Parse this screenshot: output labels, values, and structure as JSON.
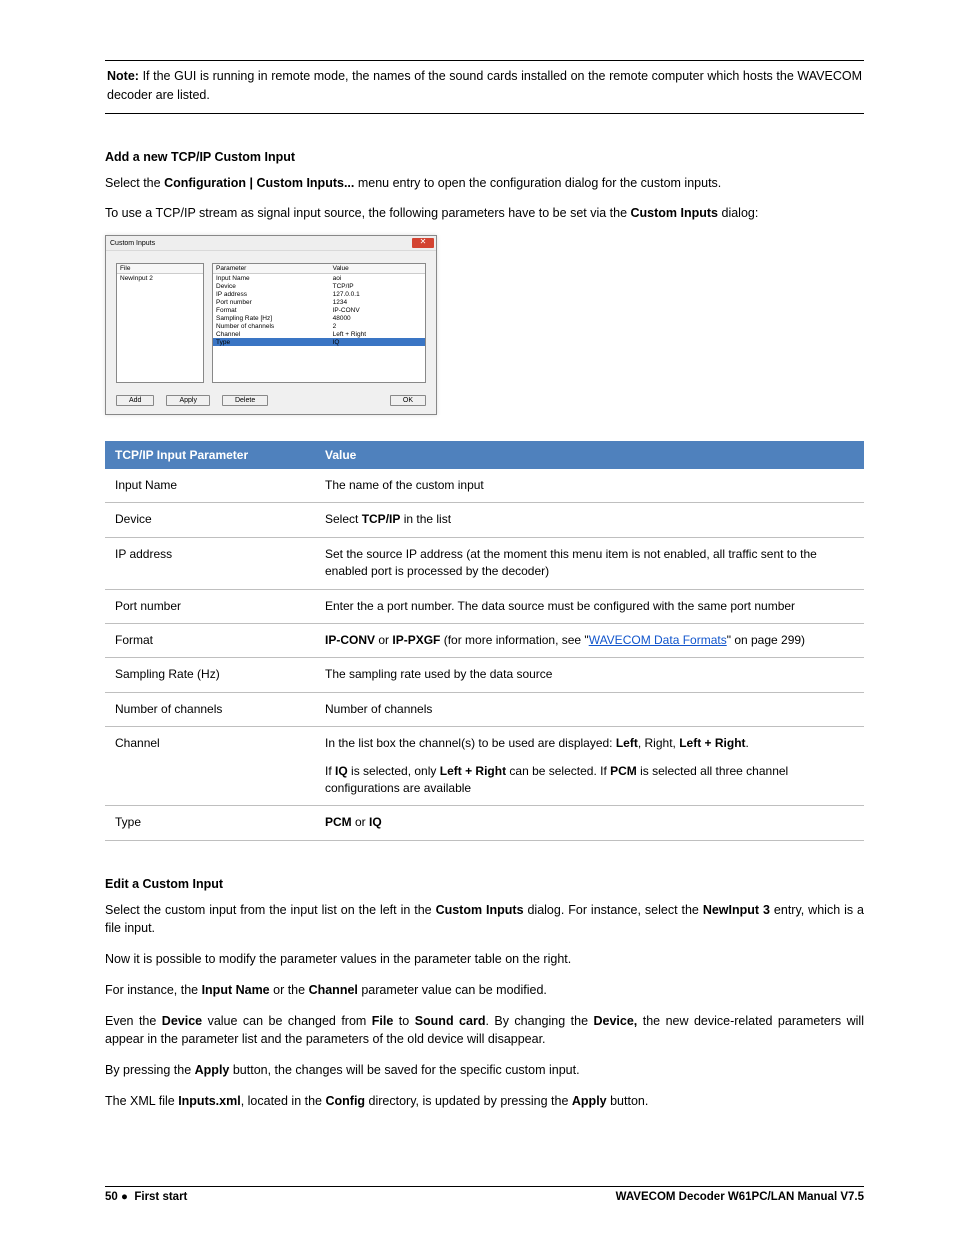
{
  "note": {
    "label": "Note:",
    "body": " If the GUI is running in remote mode, the names of the sound cards installed on the remote computer which hosts the WAVECOM decoder are listed."
  },
  "heading_add": "Add a new TCP/IP Custom Input",
  "para1a": "Select the ",
  "para1b": "Configuration | Custom Inputs...",
  "para1c": " menu entry to open the configuration dialog for the custom inputs.",
  "para2a": "To use a TCP/IP stream as signal input source, the following parameters have to be set via the ",
  "para2b": "Custom Inputs",
  "para2c": " dialog:",
  "screenshot": {
    "title": "Custom Inputs",
    "list_header": "File",
    "list_item": "NewInput 2",
    "cols": {
      "param": "Parameter",
      "value": "Value"
    },
    "rows": [
      {
        "p": "Input Name",
        "v": "aoi"
      },
      {
        "p": "Device",
        "v": "TCP/IP"
      },
      {
        "p": "IP address",
        "v": "127.0.0.1"
      },
      {
        "p": "Port number",
        "v": "1234"
      },
      {
        "p": "Format",
        "v": "IP-CONV",
        "gray": true
      },
      {
        "p": "Sampling Rate [Hz]",
        "v": "48000"
      },
      {
        "p": "Number of channels",
        "v": "2"
      },
      {
        "p": "Channel",
        "v": "Left + Right"
      },
      {
        "p": "Type",
        "v": "IQ",
        "hi": true
      }
    ],
    "buttons": {
      "add": "Add",
      "apply": "Apply",
      "delete": "Delete",
      "ok": "OK"
    }
  },
  "table": {
    "header_param": "TCP/IP Input Parameter",
    "header_value": "Value",
    "r1p": "Input Name",
    "r1v": "The name of the custom input",
    "r2p": "Device",
    "r2v_a": "Select ",
    "r2v_b": "TCP/IP",
    "r2v_c": " in the list",
    "r3p": "IP address",
    "r3v": "Set the source IP address (at the moment this menu item is not enabled, all traffic sent to the enabled port is processed by the decoder)",
    "r4p": "Port number",
    "r4v": "Enter the a port number. The data source must be configured with the same port number",
    "r5p": "Format",
    "r5v_a": "IP-CONV",
    "r5v_b": " or ",
    "r5v_c": "IP-PXGF",
    "r5v_d": "  (for more information, see \"",
    "r5v_link": "WAVECOM Data Formats",
    "r5v_e": "\" on page 299)",
    "r6p": "Sampling Rate (Hz)",
    "r6v": "The sampling rate used by the data source",
    "r7p": "Number of channels",
    "r7v": "Number of channels",
    "r8p": "Channel",
    "r8v1_a": "In the list box the channel(s) to be used are displayed: ",
    "r8v1_b": "Left",
    "r8v1_c": ", Right, ",
    "r8v1_d": "Left + Right",
    "r8v1_e": ".",
    "r8v2_a": "If ",
    "r8v2_b": "IQ",
    "r8v2_c": " is selected, only ",
    "r8v2_d": "Left + Right",
    "r8v2_e": " can be selected. If ",
    "r8v2_f": "PCM",
    "r8v2_g": "  is selected all three channel configurations are available",
    "r9p": "Type",
    "r9v_a": "PCM",
    "r9v_b": " or ",
    "r9v_c": "IQ"
  },
  "heading_edit": "Edit a Custom Input",
  "edit_p1_a": "Select the custom input from the input list on the left in the ",
  "edit_p1_b": "Custom Inputs",
  "edit_p1_c": " dialog. For instance, select the ",
  "edit_p1_d": "NewInput 3",
  "edit_p1_e": " entry, which is a file input.",
  "edit_p2": "Now it is possible to modify the parameter values in the parameter table on the right.",
  "edit_p3_a": "For instance, the ",
  "edit_p3_b": "Input Name",
  "edit_p3_c": " or the ",
  "edit_p3_d": "Channel",
  "edit_p3_e": " parameter value can be modified.",
  "edit_p4_a": "Even the ",
  "edit_p4_b": "Device",
  "edit_p4_c": " value can be changed from ",
  "edit_p4_d": "File",
  "edit_p4_e": " to ",
  "edit_p4_f": "Sound card",
  "edit_p4_g": ". By changing the ",
  "edit_p4_h": "Device,",
  "edit_p4_i": " the new device-related parameters will appear in the parameter list and the parameters of the old device will disappear.",
  "edit_p5_a": "By pressing the ",
  "edit_p5_b": "Apply",
  "edit_p5_c": " button, the changes will be saved for the specific custom input.",
  "edit_p6_a": "The XML file ",
  "edit_p6_b": "Inputs.xml",
  "edit_p6_c": ", located in the ",
  "edit_p6_d": "Config",
  "edit_p6_e": " directory, is updated by pressing the ",
  "edit_p6_f": "Apply",
  "edit_p6_g": " button.",
  "footer": {
    "page": "50",
    "section": "First start",
    "product": "WAVECOM Decoder W61PC/LAN Manual V7.5"
  }
}
